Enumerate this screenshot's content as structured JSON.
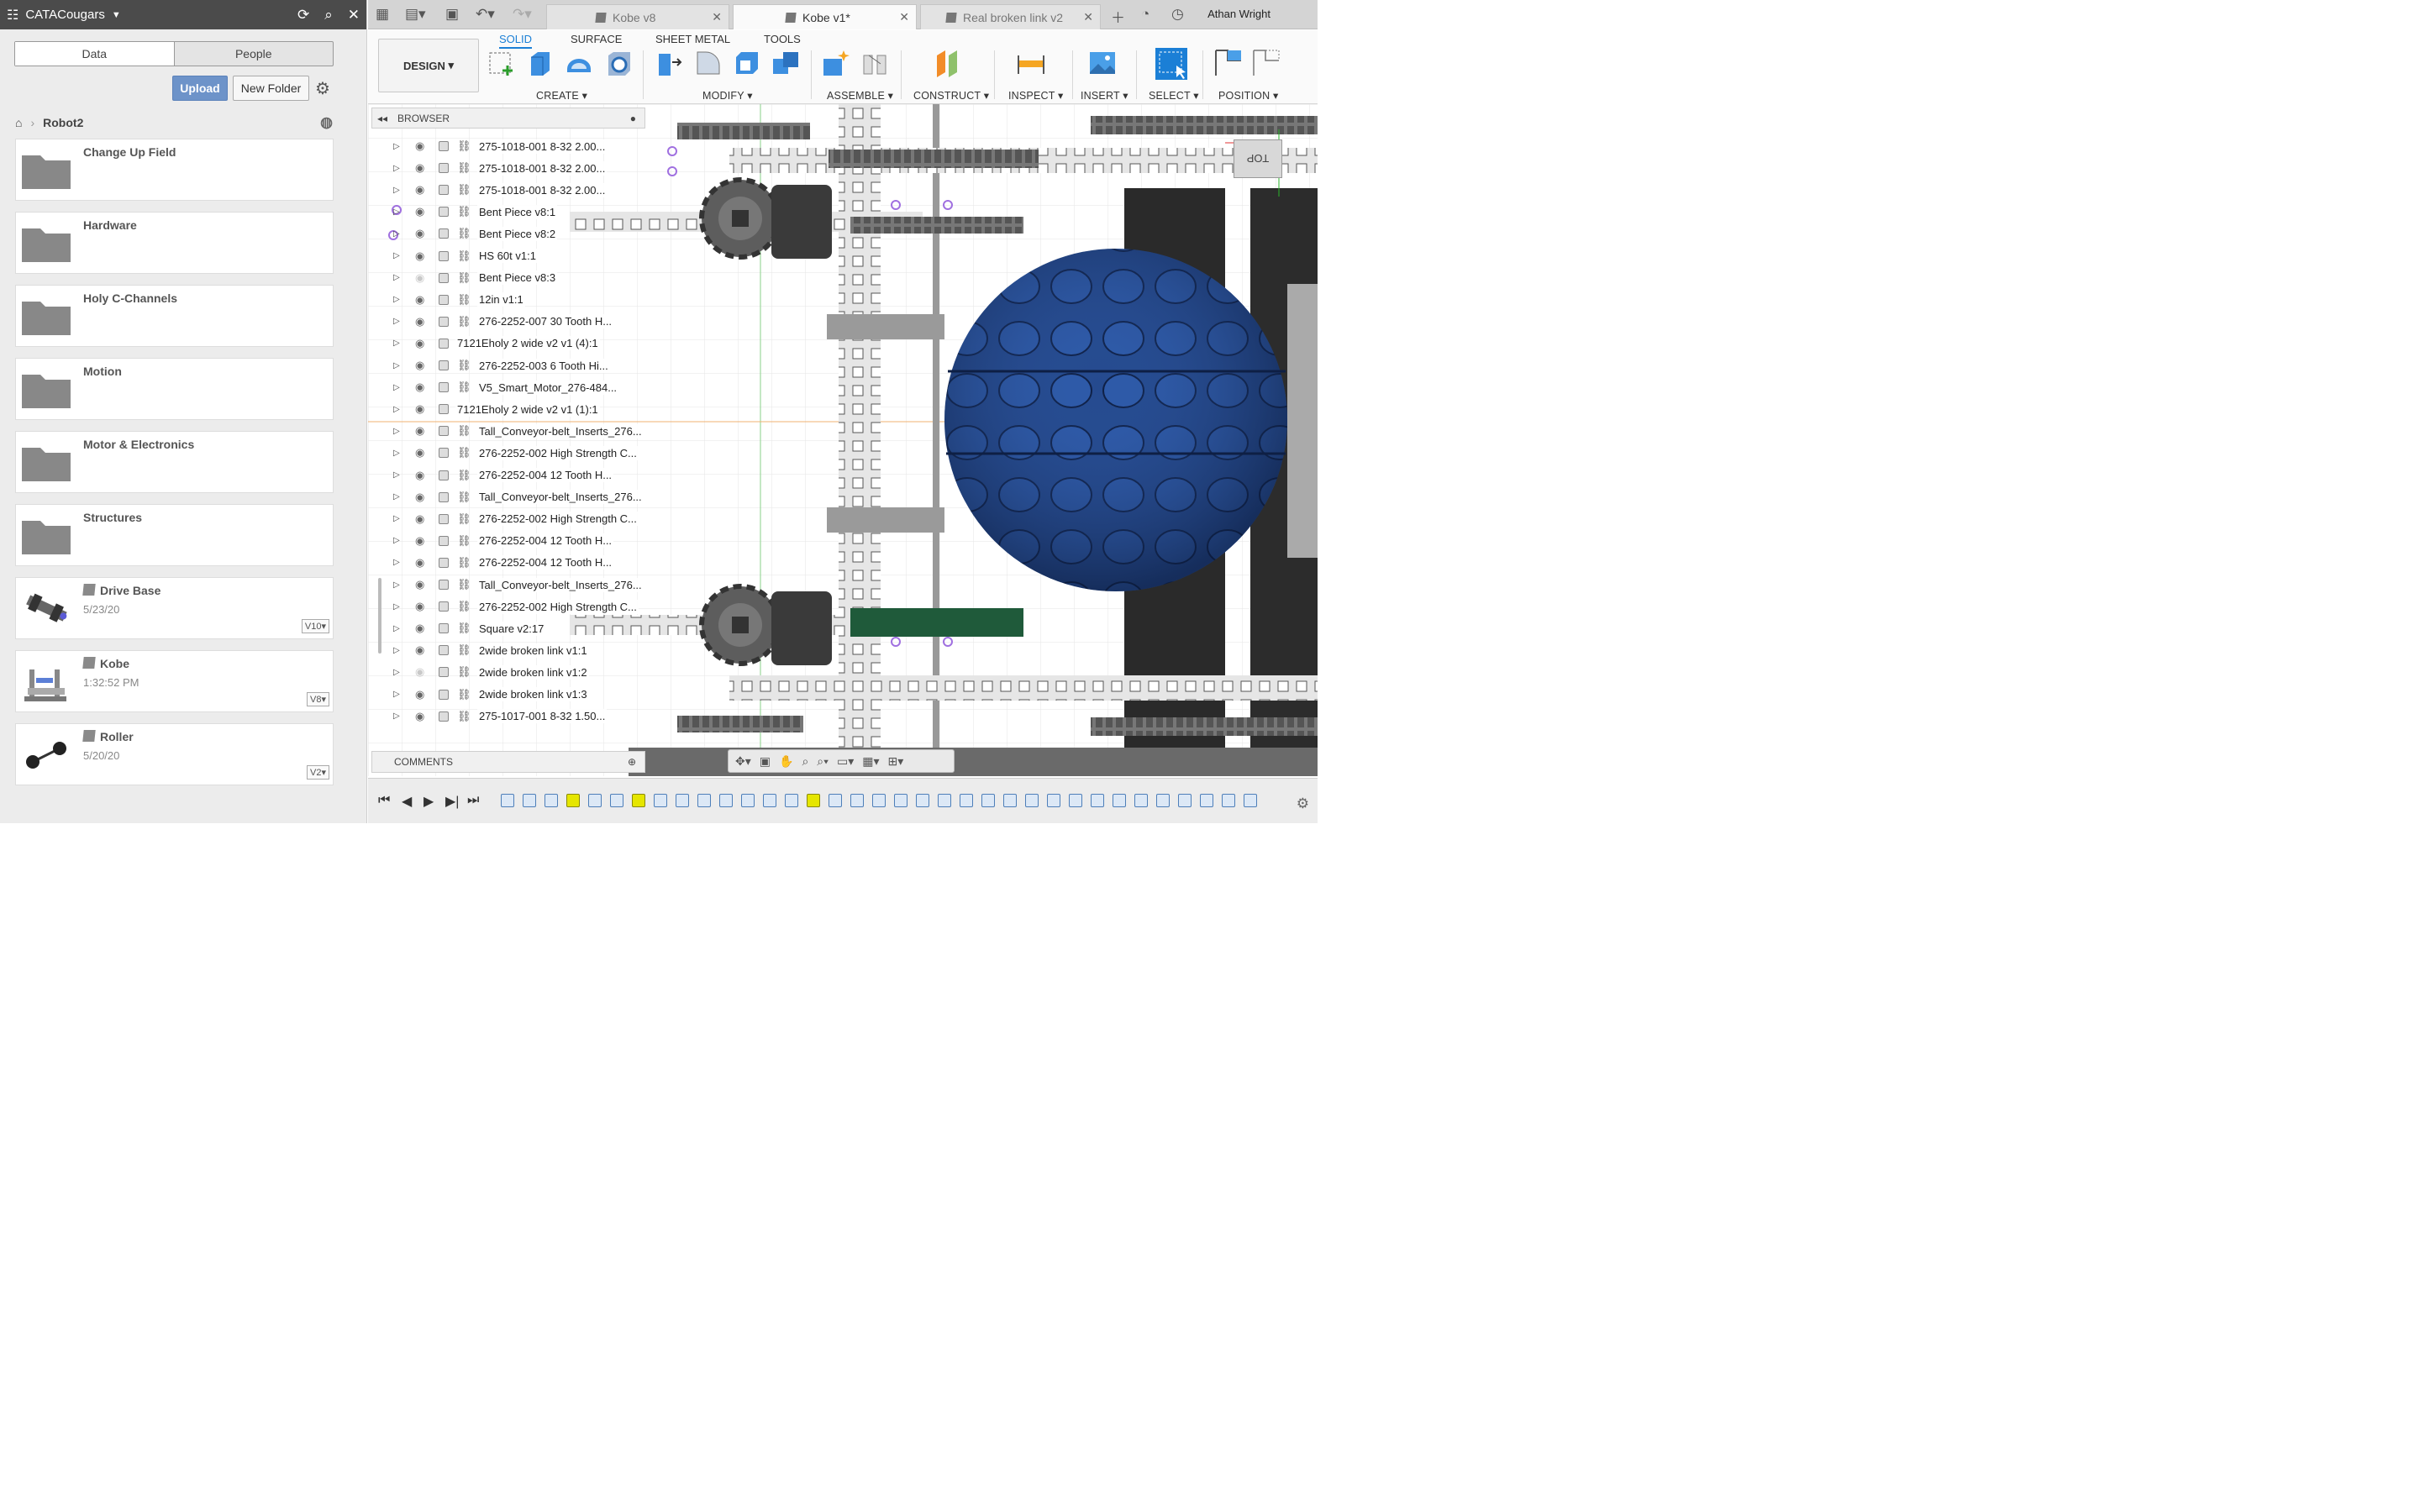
{
  "data_panel": {
    "team_name": "CATACougars",
    "tabs": [
      "Data",
      "People"
    ],
    "upload_label": "Upload",
    "new_folder_label": "New Folder",
    "breadcrumb": {
      "current": "Robot2"
    },
    "folders": [
      "Change Up Field",
      "Hardware",
      "Holy C-Channels",
      "Motion",
      "Motor & Electronics",
      "Structures"
    ],
    "designs": [
      {
        "name": "Drive Base",
        "meta": "5/23/20",
        "version": "V10▾"
      },
      {
        "name": "Kobe",
        "meta": "1:32:52 PM",
        "version": "V8▾"
      },
      {
        "name": "Roller",
        "meta": "5/20/20",
        "version": "V2▾"
      }
    ]
  },
  "tabs": [
    {
      "label": "Kobe v8"
    },
    {
      "label": "Kobe v1*"
    },
    {
      "label": "Real broken link v2"
    }
  ],
  "user": {
    "name": "Athan Wright"
  },
  "toolbar": {
    "workspace": "DESIGN",
    "workspace_tabs": [
      "SOLID",
      "SURFACE",
      "SHEET METAL",
      "TOOLS"
    ],
    "groups": [
      "CREATE ▾",
      "MODIFY ▾",
      "ASSEMBLE ▾",
      "CONSTRUCT ▾",
      "INSPECT ▾",
      "INSERT ▾",
      "SELECT ▾",
      "POSITION ▾"
    ]
  },
  "browser": {
    "title": "BROWSER",
    "comments_title": "COMMENTS",
    "items": [
      "275-1018-001 8-32 2.00...",
      "275-1018-001 8-32 2.00...",
      "275-1018-001 8-32 2.00...",
      "Bent Piece v8:1",
      "Bent Piece v8:2",
      "HS 60t v1:1",
      "Bent Piece v8:3",
      "12in v1:1",
      "276-2252-007 30 Tooth H...",
      "7121Eholy 2 wide v2 v1 (4):1",
      "276-2252-003 6 Tooth Hi...",
      "V5_Smart_Motor_276-484...",
      "7121Eholy 2 wide v2 v1 (1):1",
      "Tall_Conveyor-belt_Inserts_276...",
      "276-2252-002 High Strength C...",
      "276-2252-004 12 Tooth H...",
      "Tall_Conveyor-belt_Inserts_276...",
      "276-2252-002 High Strength C...",
      "276-2252-004 12 Tooth H...",
      "276-2252-004 12 Tooth H...",
      "Tall_Conveyor-belt_Inserts_276...",
      "276-2252-002 High Strength C...",
      "Square v2:17",
      "2wide broken link v1:1",
      "2wide broken link v1:2",
      "2wide broken link v1:3",
      "275-1017-001 8-32 1.50..."
    ]
  },
  "viewcube_label": "TOP",
  "colors": {
    "accent": "#1b7fd6",
    "upload": "#6d93c9",
    "ball": "#1f3d7a"
  }
}
